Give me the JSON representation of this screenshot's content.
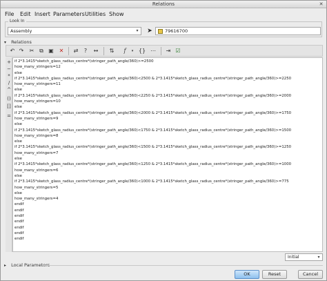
{
  "window": {
    "title": "Relations",
    "close_glyph": "✕"
  },
  "menu": [
    "File",
    "Edit",
    "Insert",
    "Parameters",
    "Utilities",
    "Show"
  ],
  "look_in": {
    "label": "Look In",
    "type_value": "Assembly",
    "model_value": "79616700"
  },
  "relations_header": "Relations",
  "toolbar_icons": [
    "undo-icon",
    "redo-icon",
    "cut-icon",
    "copy-icon",
    "paste-icon",
    "delete-icon",
    "switch-dims-icon",
    "param-info-icon",
    "dim-icon",
    "sort-icon",
    "function-icon",
    "brackets-icon",
    "evaluate-icon",
    "verify-icon"
  ],
  "sidebar_icons": [
    "plus-icon",
    "minus-icon",
    "multiply-icon",
    "divide-icon",
    "power-icon",
    "parens-icon",
    "brackets-icon",
    "equals-icon"
  ],
  "code_lines": [
    "if 2*3.1415*sketch_glass_radius_centre*(stringer_path_angle/360)>=2500",
    "how_many_stringers=12",
    "else",
    "if 2*3.1415*sketch_glass_radius_centre*(stringer_path_angle/360)<2500 & 2*3.1415*sketch_glass_radius_centre*(stringer_path_angle/360)>=2250",
    "how_many_stringers=11",
    "else",
    "if 2*3.1415*sketch_glass_radius_centre*(stringer_path_angle/360)<2250 & 2*3.1415*sketch_glass_radius_centre*(stringer_path_angle/360)>=2000",
    "how_many_stringers=10",
    "else",
    "if 2*3.1415*sketch_glass_radius_centre*(stringer_path_angle/360)<2000 & 2*3.1415*sketch_glass_radius_centre*(stringer_path_angle/360)>=1750",
    "how_many_stringers=9",
    "else",
    "if 2*3.1415*sketch_glass_radius_centre*(stringer_path_angle/360)<1750 & 2*3.1415*sketch_glass_radius_centre*(stringer_path_angle/360)>=1500",
    "how_many_stringers=8",
    "else",
    "if 2*3.1415*sketch_glass_radius_centre*(stringer_path_angle/360)<1500 & 2*3.1415*sketch_glass_radius_centre*(stringer_path_angle/360)>=1250",
    "how_many_stringers=7",
    "else",
    "if 2*3.1415*sketch_glass_radius_centre*(stringer_path_angle/360)<1250 & 2*3.1415*sketch_glass_radius_centre*(stringer_path_angle/360)>=1000",
    "how_many_stringers=6",
    "else",
    "if 2*3.1415*sketch_glass_radius_centre*(stringer_path_angle/360)<1000 & 2*3.1415*sketch_glass_radius_centre*(stringer_path_angle/360)>=775",
    "how_many_stringers=5",
    "else",
    "how_many_stringers=4",
    "endif",
    "endif",
    "endif",
    "endif",
    "endif",
    "endif",
    "endif"
  ],
  "units_select": "Initial",
  "local_parameters": "Local Parameters",
  "buttons": {
    "ok": "OK",
    "reset": "Reset",
    "cancel": "Cancel"
  },
  "colors": {
    "ok_button": "#8ec0ee",
    "window_bg": "#ececec"
  }
}
